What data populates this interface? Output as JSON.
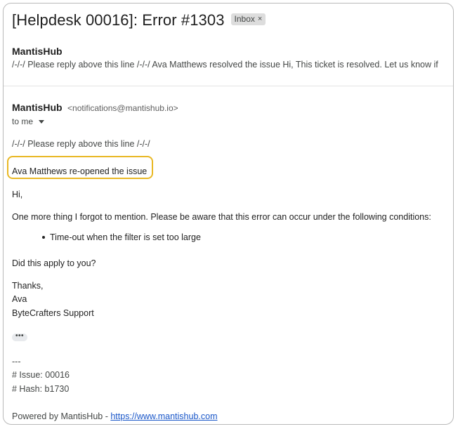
{
  "email": {
    "subject": "[Helpdesk 00016]: Error #1303",
    "label": "Inbox",
    "label_close": "×"
  },
  "preview": {
    "sender": "MantisHub",
    "snippet": "/-/-/ Please reply above this line /-/-/ Ava Matthews resolved the issue Hi, This ticket is resolved. Let us know if"
  },
  "message": {
    "sender_name": "MantisHub",
    "sender_email": "<notifications@mantishub.io>",
    "recipient": "to me",
    "reply_marker": "/-/-/ Please reply above this line /-/-/",
    "event": "Ava Matthews re-opened the issue",
    "greeting": "Hi,",
    "paragraph": "One more thing I forgot to mention. Please be aware that this error can occur under the following conditions:",
    "bullets": [
      "Time-out when the filter is set too large"
    ],
    "question": "Did this apply to you?",
    "signoff": "Thanks,",
    "signature_name": "Ava",
    "signature_org": "ByteCrafters Support",
    "more_label": "•••",
    "separator": "---",
    "issue_line": "# Issue: 00016",
    "hash_line": "# Hash: b1730",
    "powered_prefix": "Powered by MantisHub - ",
    "powered_link": "https://www.mantishub.com"
  },
  "colors": {
    "highlight_border": "#e9b824",
    "link": "#1a57c9"
  }
}
